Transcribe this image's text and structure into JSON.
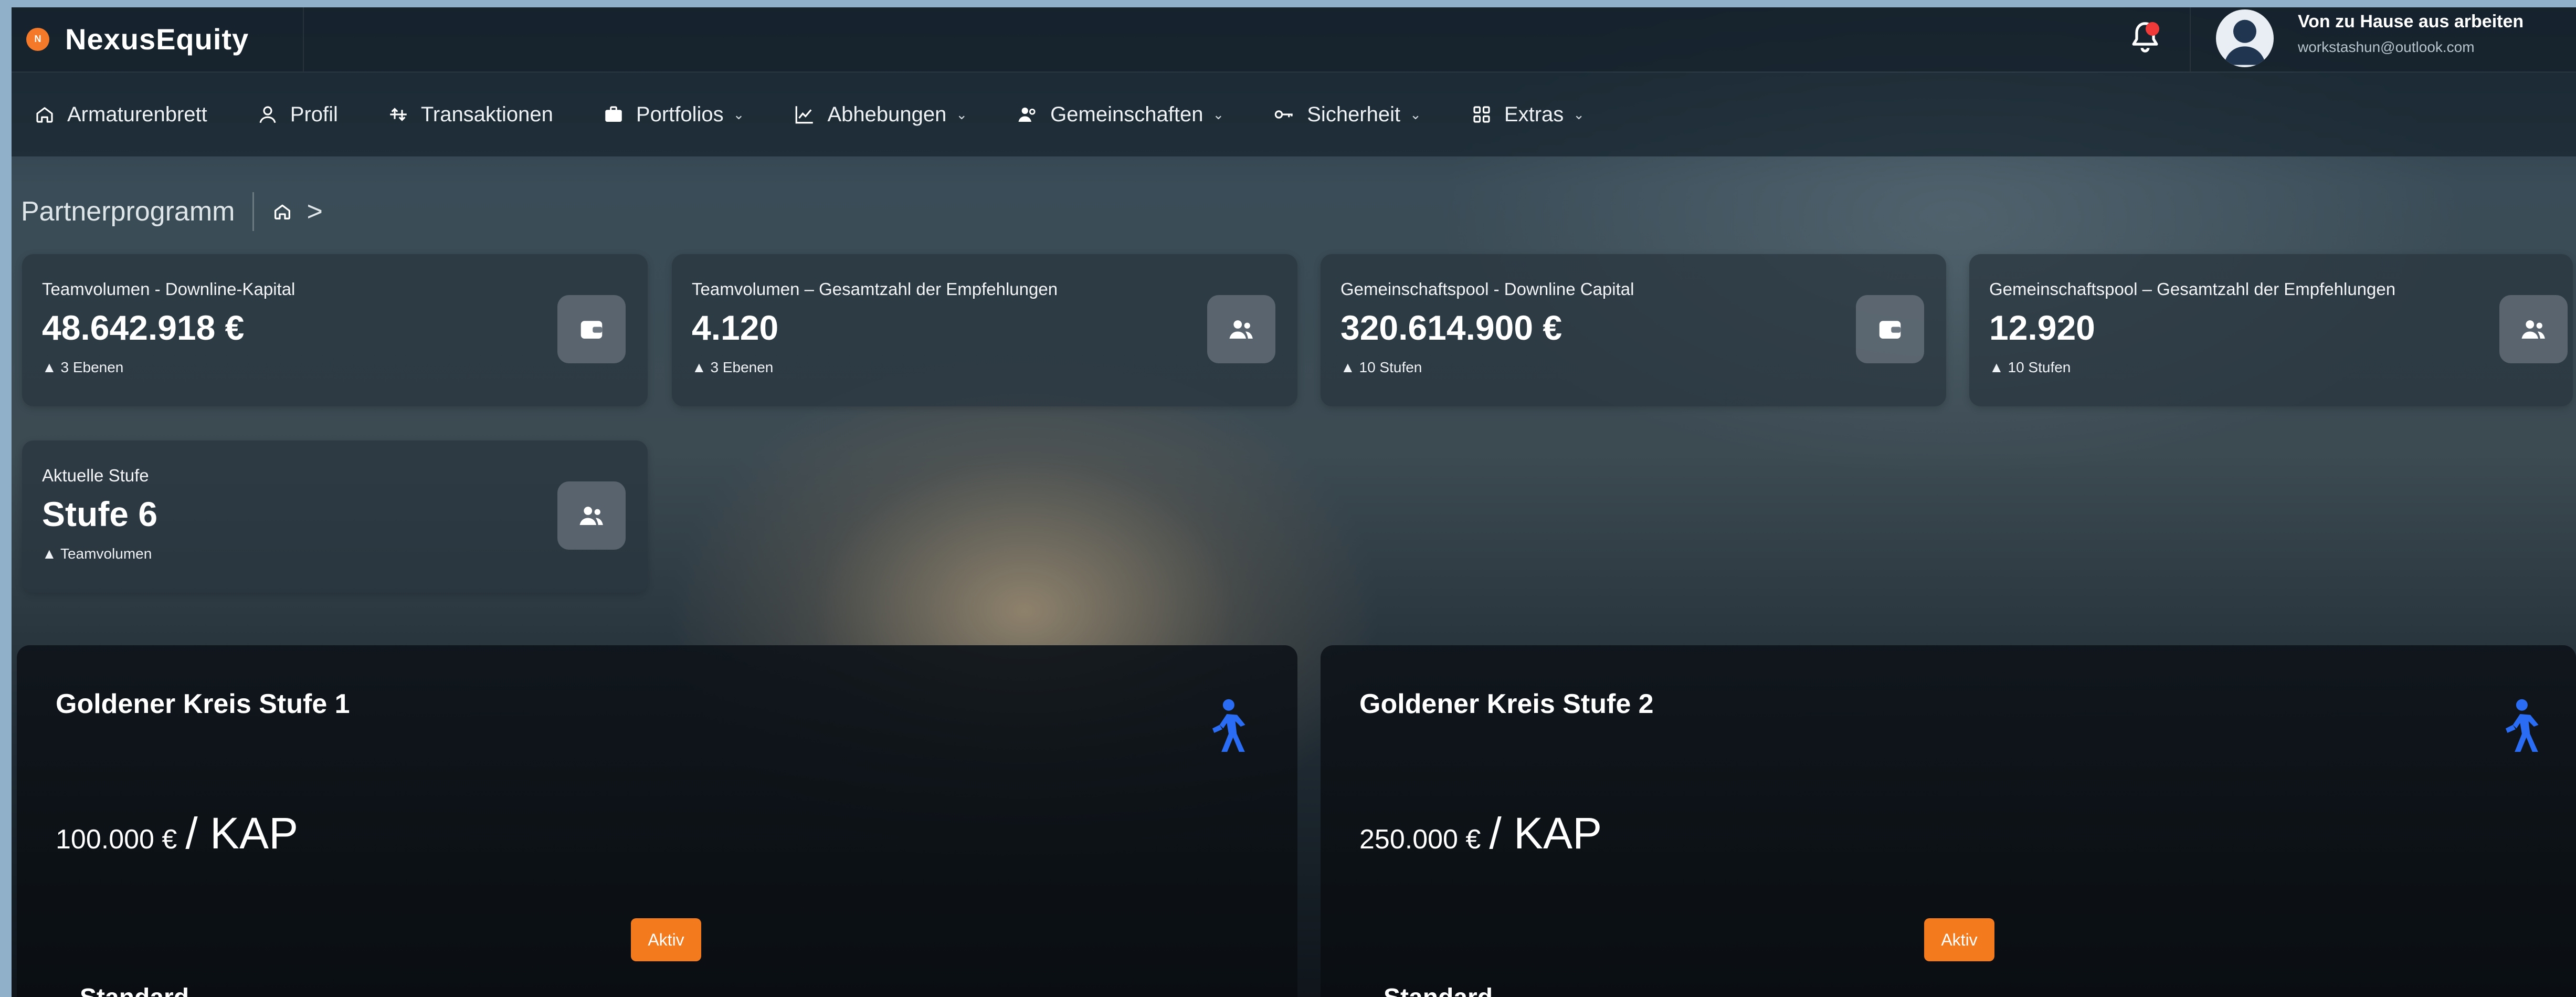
{
  "header": {
    "brand_initial": "N",
    "brand_name": "NexusEquity",
    "user_name": "Von zu Hause aus arbeiten",
    "user_email": "workstashun@outlook.com"
  },
  "nav": [
    {
      "label": "Armaturenbrett",
      "icon": "home-icon",
      "dropdown": false
    },
    {
      "label": "Profil",
      "icon": "user-icon",
      "dropdown": false
    },
    {
      "label": "Transaktionen",
      "icon": "transactions-icon",
      "dropdown": false
    },
    {
      "label": "Portfolios",
      "icon": "briefcase-icon",
      "dropdown": true
    },
    {
      "label": "Abhebungen",
      "icon": "chart-line-icon",
      "dropdown": true
    },
    {
      "label": "Gemeinschaften",
      "icon": "users-icon",
      "dropdown": true
    },
    {
      "label": "Sicherheit",
      "icon": "key-icon",
      "dropdown": true
    },
    {
      "label": "Extras",
      "icon": "grid-icon",
      "dropdown": true
    }
  ],
  "breadcrumb": {
    "title": "Partnerprogramm",
    "chevron": ">"
  },
  "stats": [
    {
      "label": "Teamvolumen - Downline-Kapital",
      "value": "48.642.918 €",
      "sub": "▲ 3 Ebenen",
      "icon": "wallet-icon"
    },
    {
      "label": "Teamvolumen – Gesamtzahl der Empfehlungen",
      "value": "4.120",
      "sub": "▲ 3 Ebenen",
      "icon": "users-icon"
    },
    {
      "label": "Gemeinschaftspool - Downline Capital",
      "value": "320.614.900 €",
      "sub": "▲ 10 Stufen",
      "icon": "wallet-icon"
    },
    {
      "label": "Gemeinschaftspool – Gesamtzahl der Empfehlungen",
      "value": "12.920",
      "sub": "▲ 10 Stufen",
      "icon": "users-icon"
    },
    {
      "label": "Aktuelle Stufe",
      "value": "Stufe 6",
      "sub": "▲ Teamvolumen",
      "icon": "users-icon"
    }
  ],
  "panels": [
    {
      "title": "Goldener Kreis Stufe 1",
      "amount": "100.000 €",
      "unit": "/ KAP",
      "badge": "Aktiv",
      "plan": "Standard",
      "icon": "walking-person-icon"
    },
    {
      "title": "Goldener Kreis Stufe 2",
      "amount": "250.000 €",
      "unit": "/ KAP",
      "badge": "Aktiv",
      "plan": "Standard",
      "icon": "walking-person-icon"
    }
  ],
  "colors": {
    "accent": "#f47a1e",
    "notification": "#f03a3a",
    "walk_icon": "#2a6df4"
  }
}
